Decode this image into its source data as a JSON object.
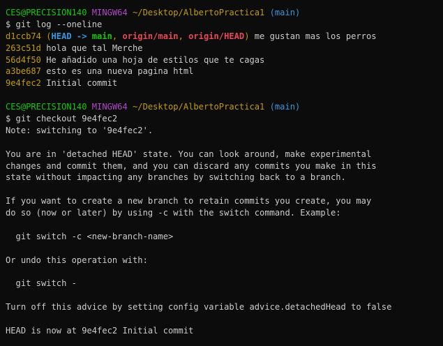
{
  "prompt": {
    "user_host": "CES@PRECISION140",
    "shell": "MINGW64",
    "path": "~/Desktop/AlbertoPractica1",
    "branch": "(main)"
  },
  "block1": {
    "command": "$ git log --oneline",
    "commits": [
      {
        "hash": "d1ccb74",
        "message": "me gustan mas los perros"
      },
      {
        "hash": "263c51d",
        "message": "hola que tal Merche"
      },
      {
        "hash": "56d4f50",
        "message": "He añadido una hoja de estilos que te cagas"
      },
      {
        "hash": "a3be687",
        "message": "esto es una nueva pagina html"
      },
      {
        "hash": "9e4fec2",
        "message": "Initial commit"
      }
    ],
    "decoration": {
      "open": "(",
      "head": "HEAD -> ",
      "main": "main",
      "sep1": ", ",
      "origin_main": "origin/main",
      "sep2": ", ",
      "origin_head": "origin/HEAD",
      "close": ")"
    }
  },
  "block2": {
    "command": "$ git checkout 9e4fec2",
    "output": [
      "Note: switching to '9e4fec2'.",
      "",
      "You are in 'detached HEAD' state. You can look around, make experimental",
      "changes and commit them, and you can discard any commits you make in this",
      "state without impacting any branches by switching back to a branch.",
      "",
      "If you want to create a new branch to retain commits you create, you may",
      "do so (now or later) by using -c with the switch command. Example:",
      "",
      "  git switch -c <new-branch-name>",
      "",
      "Or undo this operation with:",
      "",
      "  git switch -",
      "",
      "Turn off this advice by setting config variable advice.detachedHead to false",
      "",
      "HEAD is now at 9e4fec2 Initial commit"
    ]
  },
  "colors": {
    "background": "#0c0c0c",
    "foreground": "#cccccc",
    "green": "#16c60c",
    "magenta": "#b148c6",
    "yellow": "#c19c00",
    "cyan": "#3a96dd",
    "red": "#e74856"
  }
}
